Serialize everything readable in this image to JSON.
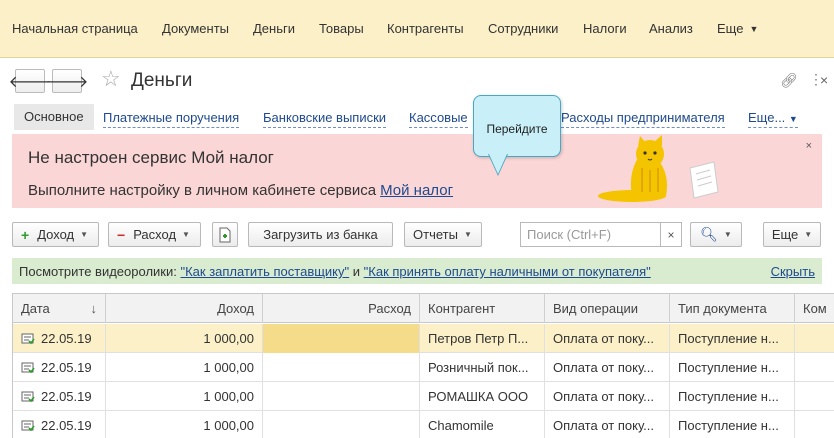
{
  "topnav": {
    "items": [
      "Начальная страница",
      "Документы",
      "Деньги",
      "Товары",
      "Контрагенты",
      "Сотрудники",
      "Налоги",
      "Анализ",
      "Еще"
    ]
  },
  "header": {
    "title": "Деньги"
  },
  "tabs": {
    "active": "Основное",
    "links": [
      "Платежные поручения",
      "Банковские выписки",
      "Кассовые",
      "Расходы предпринимателя",
      "Еще..."
    ]
  },
  "banner": {
    "heading": "Не настроен сервис Мой налог",
    "text": "Выполните настройку в личном кабинете сервиса",
    "link": "Мой налог",
    "close": "×"
  },
  "tooltip": {
    "text": "Перейдите"
  },
  "toolbar": {
    "income": "Доход",
    "expense": "Расход",
    "load_bank": "Загрузить из банка",
    "reports": "Отчеты",
    "search_placeholder": "Поиск (Ctrl+F)",
    "search_clear": "×",
    "more": "Еще"
  },
  "infobar": {
    "prefix": "Посмотрите видеоролики:",
    "link1": "\"Как заплатить поставщику\"",
    "and": "и",
    "link2": "\"Как принять оплату наличными от покупателя\"",
    "hide": "Скрыть"
  },
  "table": {
    "headers": [
      "Дата",
      "Доход",
      "Расход",
      "Контрагент",
      "Вид операции",
      "Тип документа",
      "Ком"
    ],
    "sort_arrow": "↓",
    "rows": [
      {
        "date": "22.05.19",
        "income": "1 000,00",
        "expense": "",
        "counterparty": "Петров Петр П...",
        "operation": "Оплата от поку...",
        "doctype": "Поступление н..."
      },
      {
        "date": "22.05.19",
        "income": "1 000,00",
        "expense": "",
        "counterparty": "Розничный пок...",
        "operation": "Оплата от поку...",
        "doctype": "Поступление н..."
      },
      {
        "date": "22.05.19",
        "income": "1 000,00",
        "expense": "",
        "counterparty": "РОМАШКА ООО",
        "operation": "Оплата от поку...",
        "doctype": "Поступление н..."
      },
      {
        "date": "22.05.19",
        "income": "1 000,00",
        "expense": "",
        "counterparty": "Chamomile",
        "operation": "Оплата от поку...",
        "doctype": "Поступление н..."
      }
    ]
  },
  "colors": {
    "topnav_bg": "#fbf0c8",
    "banner_bg": "#fbd6d6",
    "infobar_bg": "#d9eccf",
    "link": "#1f4a8f",
    "tooltip_bg": "#c9f0f8"
  }
}
